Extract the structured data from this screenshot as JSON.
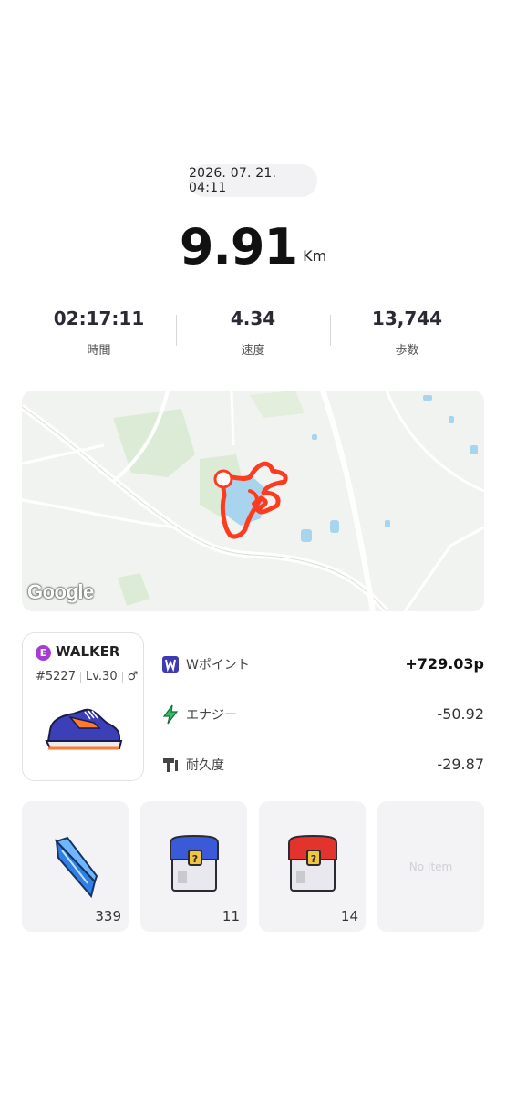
{
  "record": {
    "datetime": "2026. 07. 21. 04:11",
    "distance": "9.91",
    "distance_unit": "Km"
  },
  "stats": [
    {
      "value": "02:17:11",
      "label": "時間"
    },
    {
      "value": "4.34",
      "label": "速度"
    },
    {
      "value": "13,744",
      "label": "歩数"
    }
  ],
  "map": {
    "attribution": "Google",
    "route_color": "#ff3b1f"
  },
  "shoe": {
    "rarity_badge": "E",
    "rarity_color": "#a43cd4",
    "type": "WALKER",
    "id": "#5227",
    "level": "Lv.30",
    "gender_symbol": "♂"
  },
  "rewards": [
    {
      "icon": "w-point-icon",
      "name": "Wポイント",
      "amount": "+729.03p"
    },
    {
      "icon": "energy-bolt-icon",
      "name": "エナジー",
      "amount": "-50.92"
    },
    {
      "icon": "durability-icon",
      "name": "耐久度",
      "amount": "-29.87"
    }
  ],
  "items": [
    {
      "icon": "blue-gem-icon",
      "count": "339"
    },
    {
      "icon": "blue-mystery-box-icon",
      "count": "11"
    },
    {
      "icon": "red-mystery-box-icon",
      "count": "14"
    },
    {
      "icon": "",
      "empty_label": "No Item"
    }
  ]
}
